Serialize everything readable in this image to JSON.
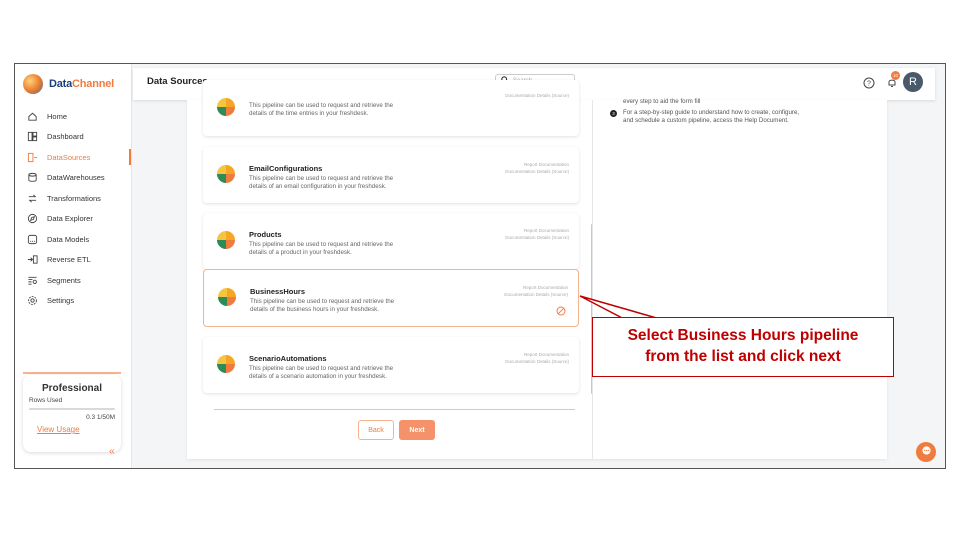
{
  "brand": {
    "name_part1": "Data",
    "name_part2": "Channel"
  },
  "sidebar": {
    "items": [
      {
        "label": "Home",
        "icon": "home-icon"
      },
      {
        "label": "Dashboard",
        "icon": "dashboard-icon"
      },
      {
        "label": "DataSources",
        "icon": "datasource-icon",
        "active": true
      },
      {
        "label": "DataWarehouses",
        "icon": "warehouse-icon"
      },
      {
        "label": "Transformations",
        "icon": "transform-icon"
      },
      {
        "label": "Data Explorer",
        "icon": "explorer-icon"
      },
      {
        "label": "Data Models",
        "icon": "model-icon"
      },
      {
        "label": "Reverse ETL",
        "icon": "reverse-etl-icon"
      },
      {
        "label": "Segments",
        "icon": "segments-icon"
      },
      {
        "label": "Settings",
        "icon": "settings-icon"
      }
    ],
    "plan": {
      "title": "Professional",
      "rows_label": "Rows Used",
      "count": "0.3 1/50M",
      "link": "View Usage",
      "used_fraction": 0.006
    }
  },
  "header": {
    "title": "Data Sources",
    "search_placeholder": "Search...",
    "notification_count": "10",
    "avatar_initial": "R"
  },
  "pipelines": [
    {
      "name": "",
      "desc_line1": "This pipeline can be used to request and retrieve the",
      "desc_line2": "details of the time entries in your freshdesk.",
      "link1": "",
      "link2": "Documentation Details (Source)"
    },
    {
      "name": "EmailConfigurations",
      "desc_line1": "This pipeline can be used to request and retrieve the",
      "desc_line2": "details of an email configuration in your freshdesk.",
      "link1": "Report Documentation",
      "link2": "Documentation Details (Source)"
    },
    {
      "name": "Products",
      "desc_line1": "This pipeline can be used to request and retrieve the",
      "desc_line2": "details of a product in your freshdesk.",
      "link1": "Report Documentation",
      "link2": "Documentation Details (Source)"
    },
    {
      "name": "BusinessHours",
      "desc_line1": "This pipeline can be used to request and retrieve the",
      "desc_line2": "details of the business hours in your freshdesk.",
      "link1": "Report Documentation",
      "link2": "Documentation Details (Source)",
      "selected": true
    },
    {
      "name": "ScenarioAutomations",
      "desc_line1": "This pipeline can be used to request and retrieve the",
      "desc_line2": "details of a scenario automation in your freshdesk.",
      "link1": "Report Documentation",
      "link2": "Documentation Details (Source)"
    }
  ],
  "buttons": {
    "back": "Back",
    "next": "Next"
  },
  "help": {
    "line0": "every step to aid the form fill",
    "bullet": "3",
    "line1": "For a step-by-step guide to understand how to create, configure,",
    "line2": "and schedule a custom pipeline, access the Help Document."
  },
  "callout": {
    "line1": "Select Business Hours pipeline",
    "line2": "from the list and click next"
  },
  "colors": {
    "accent": "#f07b3f",
    "callout": "#c00000",
    "brand_blue": "#1b3f7a"
  }
}
